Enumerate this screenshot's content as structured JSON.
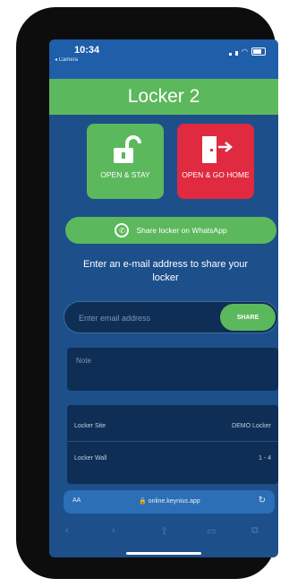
{
  "status": {
    "time": "10:34",
    "back_label": "◂ Camera"
  },
  "header": {
    "title": "Locker 2"
  },
  "actions": {
    "open_stay_label": "OPEN & STAY",
    "open_go_home_label": "OPEN & GO HOME"
  },
  "whatsapp": {
    "label": "Share locker on WhatsApp"
  },
  "share": {
    "prompt": "Enter an e-mail address to share your locker",
    "email_placeholder": "Enter email address",
    "email_value": "",
    "share_label": "SHARE"
  },
  "notes": {
    "placeholder": "Note"
  },
  "details": [
    {
      "key": "Locker Site",
      "value": "DEMO Locker"
    },
    {
      "key": "Locker Wall",
      "value": "1 - 4"
    }
  ],
  "browser": {
    "aa": "AA",
    "url": "🔒 online.keynius.app",
    "reload": "↻",
    "toolbar": [
      "‹",
      "›",
      "⇪",
      "▭",
      "⧉"
    ]
  },
  "colors": {
    "primary_green": "#5cb85c",
    "danger_red": "#e02a3f",
    "background_blue": "#1d4f8b",
    "panel_navy": "#0f2e55"
  },
  "icons": {
    "open_stay": "unlocked-padlock-icon",
    "open_go_home": "door-exit-arrow-icon",
    "whatsapp": "whatsapp-icon"
  }
}
